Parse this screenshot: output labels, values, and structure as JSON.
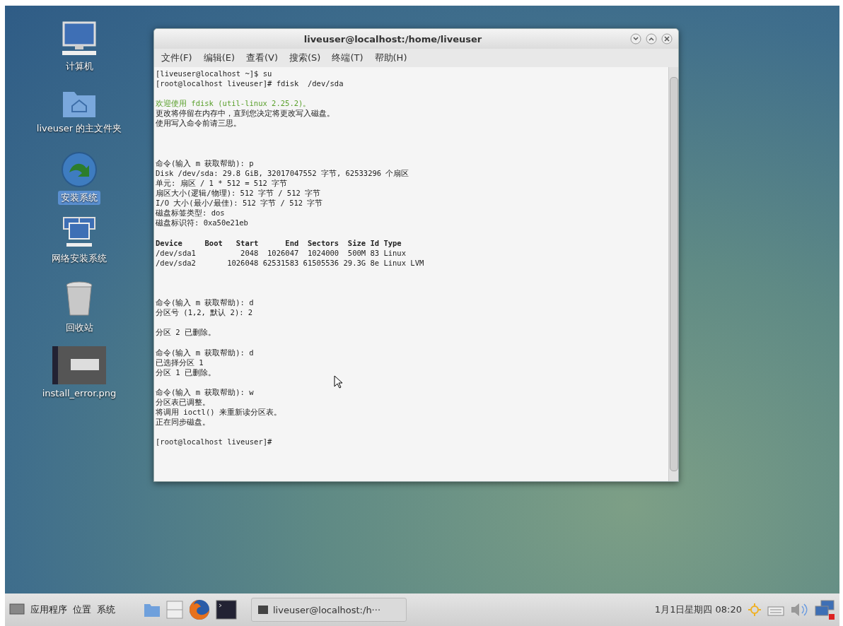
{
  "desktop_icons": [
    {
      "kind": "computer",
      "label": "计算机",
      "selected": false
    },
    {
      "kind": "home",
      "label": "liveuser 的主文件夹",
      "selected": false
    },
    {
      "kind": "install",
      "label": "安装系统",
      "selected": true
    },
    {
      "kind": "network",
      "label": "网络安装系统",
      "selected": false
    },
    {
      "kind": "trash",
      "label": "回收站",
      "selected": false
    },
    {
      "kind": "image",
      "label": "install_error.png",
      "selected": false
    }
  ],
  "terminal": {
    "title": "liveuser@localhost:/home/liveuser",
    "menu": [
      "文件(F)",
      "编辑(E)",
      "查看(V)",
      "搜索(S)",
      "终端(T)",
      "帮助(H)"
    ],
    "lines": [
      {
        "kind": "plain",
        "text": "[liveuser@localhost ~]$ su"
      },
      {
        "kind": "plain",
        "text": "[root@localhost liveuser]# fdisk  /dev/sda"
      },
      {
        "kind": "blank"
      },
      {
        "kind": "welcome",
        "text": "欢迎使用 fdisk (util-linux 2.25.2)。"
      },
      {
        "kind": "plain",
        "text": "更改将停留在内存中，直到您决定将更改写入磁盘。"
      },
      {
        "kind": "plain",
        "text": "使用写入命令前请三思。"
      },
      {
        "kind": "blank"
      },
      {
        "kind": "blank"
      },
      {
        "kind": "blank"
      },
      {
        "kind": "plain",
        "text": "命令(输入 m 获取帮助): p"
      },
      {
        "kind": "plain",
        "text": "Disk /dev/sda: 29.8 GiB, 32017047552 字节, 62533296 个扇区"
      },
      {
        "kind": "plain",
        "text": "单元: 扇区 / 1 * 512 = 512 字节"
      },
      {
        "kind": "plain",
        "text": "扇区大小(逻辑/物理): 512 字节 / 512 字节"
      },
      {
        "kind": "plain",
        "text": "I/O 大小(最小/最佳): 512 字节 / 512 字节"
      },
      {
        "kind": "plain",
        "text": "磁盘标签类型: dos"
      },
      {
        "kind": "plain",
        "text": "磁盘标识符: 0xa50e21eb"
      },
      {
        "kind": "blank"
      },
      {
        "kind": "header",
        "text": "Device     Boot   Start      End  Sectors  Size Id Type"
      },
      {
        "kind": "plain",
        "text": "/dev/sda1          2048  1026047  1024000  500M 83 Linux"
      },
      {
        "kind": "plain",
        "text": "/dev/sda2       1026048 62531583 61505536 29.3G 8e Linux LVM"
      },
      {
        "kind": "blank"
      },
      {
        "kind": "blank"
      },
      {
        "kind": "blank"
      },
      {
        "kind": "plain",
        "text": "命令(输入 m 获取帮助): d"
      },
      {
        "kind": "plain",
        "text": "分区号 (1,2, 默认 2): 2"
      },
      {
        "kind": "blank"
      },
      {
        "kind": "plain",
        "text": "分区 2 已删除。"
      },
      {
        "kind": "blank"
      },
      {
        "kind": "plain",
        "text": "命令(输入 m 获取帮助): d"
      },
      {
        "kind": "plain",
        "text": "已选择分区 1"
      },
      {
        "kind": "plain",
        "text": "分区 1 已删除。"
      },
      {
        "kind": "blank"
      },
      {
        "kind": "plain",
        "text": "命令(输入 m 获取帮助): w"
      },
      {
        "kind": "plain",
        "text": "分区表已调整。"
      },
      {
        "kind": "plain",
        "text": "将调用 ioctl() 来重新读分区表。"
      },
      {
        "kind": "plain",
        "text": "正在同步磁盘。"
      },
      {
        "kind": "blank"
      },
      {
        "kind": "plain",
        "text": "[root@localhost liveuser]#"
      }
    ]
  },
  "panel": {
    "menus": [
      "应用程序",
      "位置",
      "系统"
    ],
    "launchers": [
      {
        "kind": "folder"
      },
      {
        "kind": "files"
      },
      {
        "kind": "browser"
      },
      {
        "kind": "terminal"
      }
    ],
    "tasks": [
      {
        "label": "liveuser@localhost:/h···",
        "selected": false
      }
    ],
    "clock": "1月1日星期四 08:20"
  }
}
